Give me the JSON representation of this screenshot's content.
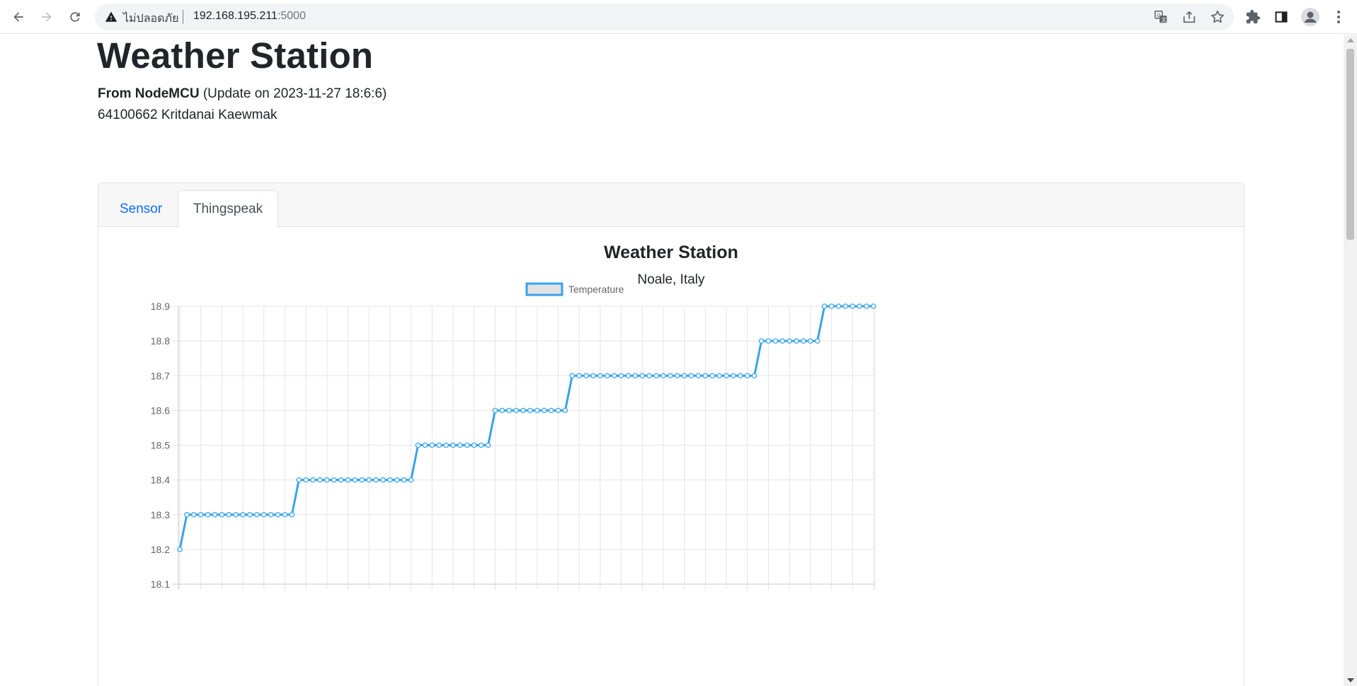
{
  "browser": {
    "insecure_label": "ไม่ปลอดภัย",
    "url_host": "192.168.195.211",
    "url_port": ":5000",
    "icons": [
      "back-icon",
      "forward-icon",
      "reload-icon",
      "warning-icon",
      "translate-icon",
      "share-icon",
      "star-icon",
      "extensions-icon",
      "side-panel-icon",
      "profile-icon",
      "menu-icon"
    ]
  },
  "page": {
    "title": "Weather Station",
    "source_label": "From NodeMCU",
    "update_text": "(Update on 2023-11-27 18:6:6)",
    "author": "64100662 Kritdanai Kaewmak"
  },
  "tabs": [
    {
      "label": "Sensor",
      "active": false
    },
    {
      "label": "Thingspeak",
      "active": true
    }
  ],
  "colors": {
    "accent": "#0d6efd",
    "line": "#36a2eb",
    "legend_fill": "#e2e2e2"
  },
  "chart_data": {
    "type": "line",
    "title": "Weather Station",
    "subtitle": "Noale, Italy",
    "series": [
      {
        "name": "Temperature",
        "values": [
          18.2,
          18.3,
          18.3,
          18.3,
          18.3,
          18.3,
          18.3,
          18.3,
          18.3,
          18.3,
          18.3,
          18.3,
          18.3,
          18.3,
          18.3,
          18.3,
          18.3,
          18.4,
          18.4,
          18.4,
          18.4,
          18.4,
          18.4,
          18.4,
          18.4,
          18.4,
          18.4,
          18.4,
          18.4,
          18.4,
          18.4,
          18.4,
          18.4,
          18.4,
          18.5,
          18.5,
          18.5,
          18.5,
          18.5,
          18.5,
          18.5,
          18.5,
          18.5,
          18.5,
          18.5,
          18.6,
          18.6,
          18.6,
          18.6,
          18.6,
          18.6,
          18.6,
          18.6,
          18.6,
          18.6,
          18.6,
          18.7,
          18.7,
          18.7,
          18.7,
          18.7,
          18.7,
          18.7,
          18.7,
          18.7,
          18.7,
          18.7,
          18.7,
          18.7,
          18.7,
          18.7,
          18.7,
          18.7,
          18.7,
          18.7,
          18.7,
          18.7,
          18.7,
          18.7,
          18.7,
          18.7,
          18.7,
          18.7,
          18.8,
          18.8,
          18.8,
          18.8,
          18.8,
          18.8,
          18.8,
          18.8,
          18.8,
          18.9,
          18.9,
          18.9,
          18.9,
          18.9,
          18.9,
          18.9,
          18.9
        ]
      }
    ],
    "y_ticks": [
      "18.9",
      "18.8",
      "18.7",
      "18.6",
      "18.5",
      "18.4",
      "18.3",
      "18.2",
      "18.1"
    ],
    "ylim": [
      18.1,
      18.9
    ],
    "grid": true,
    "legend": "top-center"
  }
}
